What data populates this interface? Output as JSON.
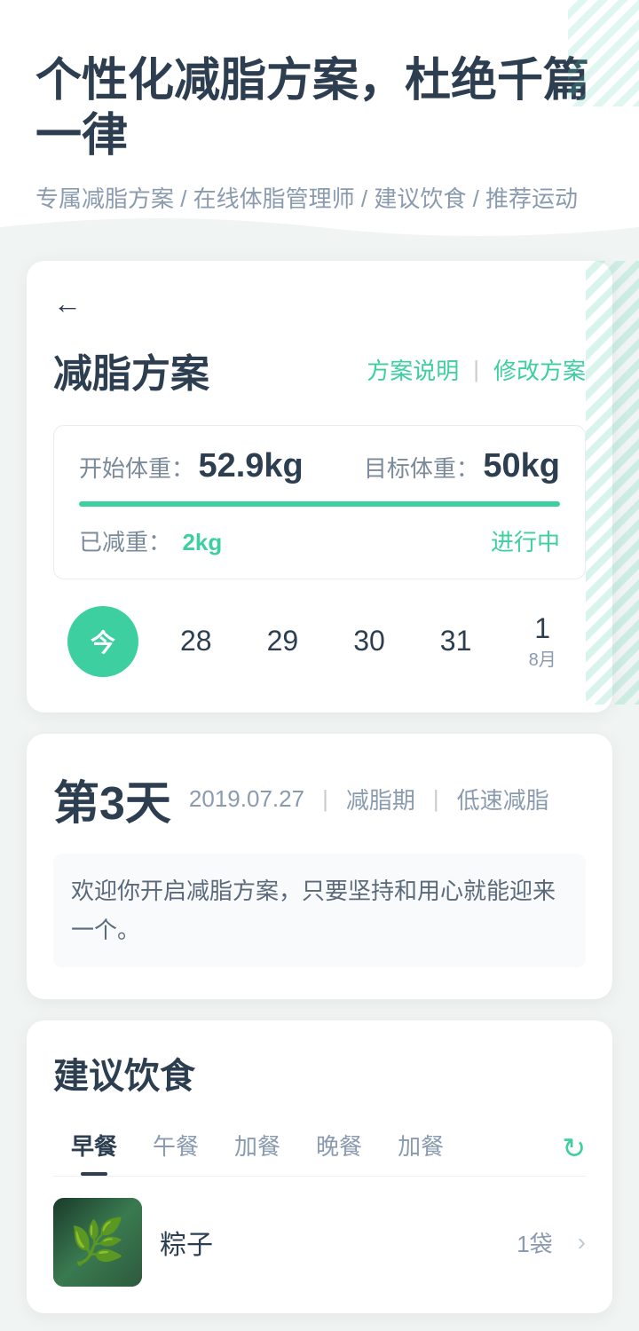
{
  "header": {
    "title": "个性化减脂方案，杜绝千篇一律",
    "subtitle": "专属减脂方案 / 在线体脂管理师 / 建议饮食 / 推荐运动"
  },
  "plan": {
    "title": "减脂方案",
    "action_explain": "方案说明",
    "action_modify": "修改方案",
    "weight": {
      "start_label": "开始体重：",
      "start_value": "52.9kg",
      "target_label": "目标体重：",
      "target_value": "50kg",
      "lost_label": "已减重：",
      "lost_value": "2kg",
      "status": "进行中"
    }
  },
  "dates": [
    {
      "label": "今",
      "active": true,
      "month": ""
    },
    {
      "label": "28",
      "active": false,
      "month": ""
    },
    {
      "label": "29",
      "active": false,
      "month": ""
    },
    {
      "label": "30",
      "active": false,
      "month": ""
    },
    {
      "label": "31",
      "active": false,
      "month": ""
    },
    {
      "label": "1",
      "active": false,
      "month": "8月"
    }
  ],
  "day": {
    "number": "第3天",
    "date": "2019.07.27",
    "tag1": "减脂期",
    "tag2": "低速减脂",
    "description": "欢迎你开启减脂方案，只要坚持和用心就能迎来一个。"
  },
  "diet": {
    "title": "建议饮食",
    "tabs": [
      {
        "label": "早餐",
        "active": true
      },
      {
        "label": "午餐",
        "active": false
      },
      {
        "label": "加餐",
        "active": false
      },
      {
        "label": "晚餐",
        "active": false
      },
      {
        "label": "加餐",
        "active": false
      }
    ],
    "food_item": {
      "name": "粽子",
      "amount": "1袋"
    }
  },
  "icons": {
    "back": "←",
    "divider": "|",
    "arrow_right": "›",
    "refresh": "↻"
  }
}
